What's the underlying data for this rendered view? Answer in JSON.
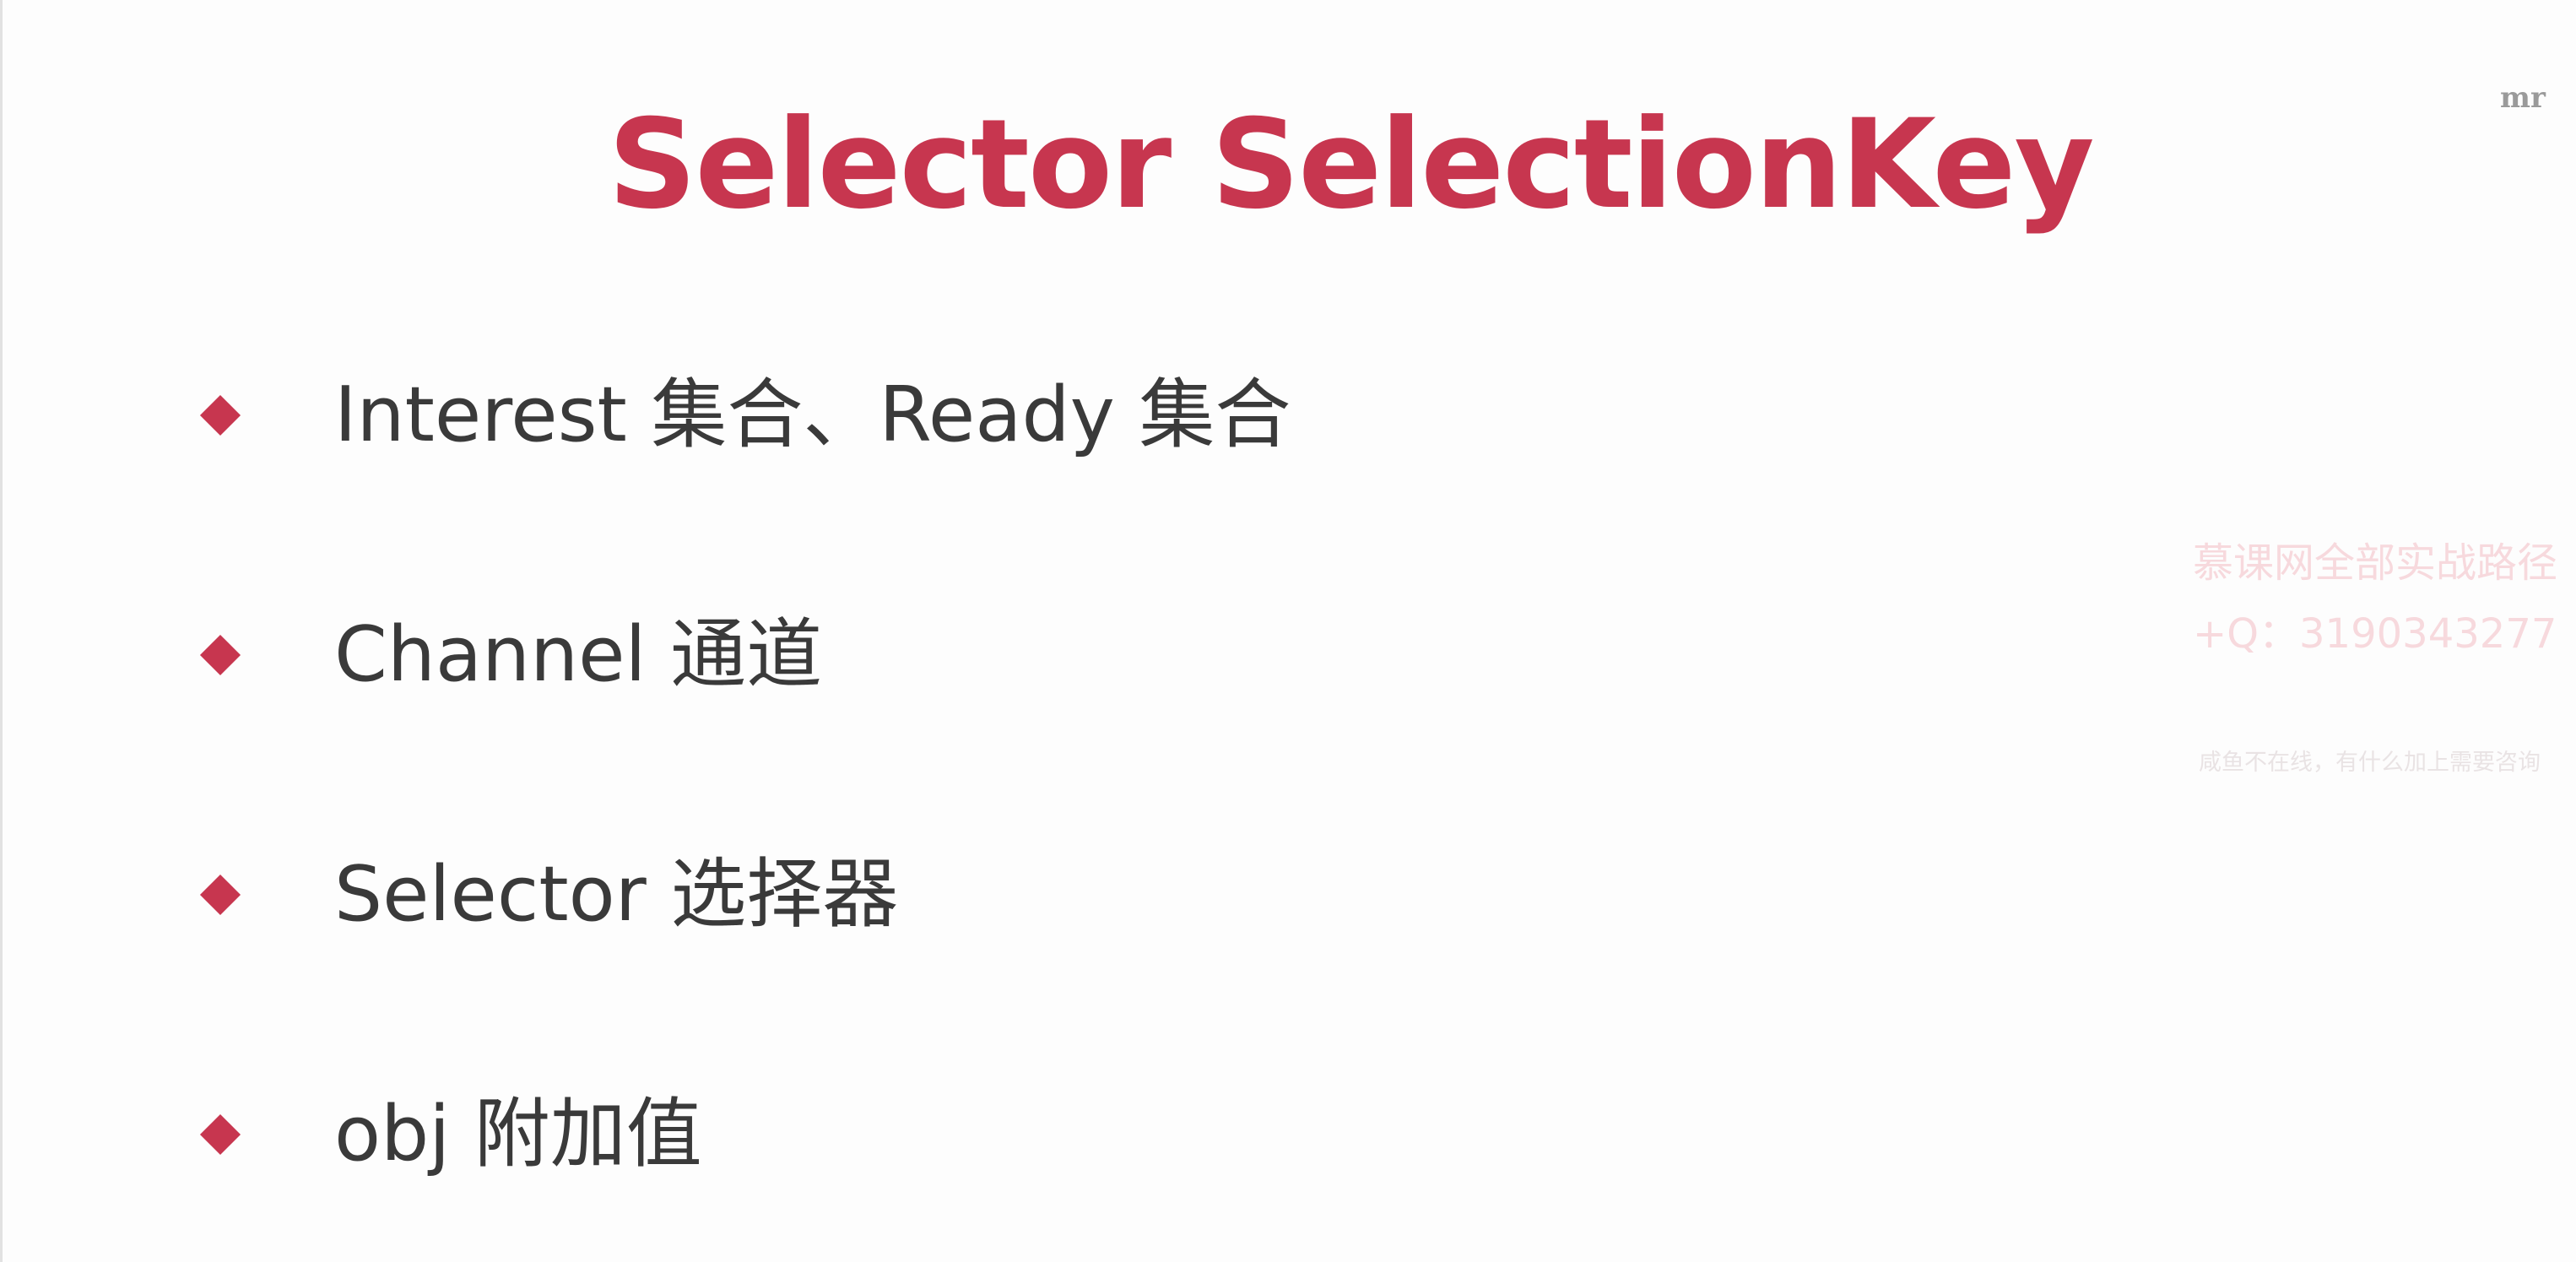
{
  "slide": {
    "title": "Selector SelectionKey",
    "corner_mark": "mr",
    "accent_color": "#c7364f",
    "text_color": "#3a3a3a",
    "bullets": [
      {
        "text": "Interest 集合、Ready 集合"
      },
      {
        "text": "Channel 通道"
      },
      {
        "text": "Selector 选择器"
      },
      {
        "text": "obj 附加值"
      }
    ],
    "watermark": {
      "line1": "慕课网全部实战路径",
      "line2": "+Q：3190343277",
      "line3": "咸鱼不在线，有什么加上需要咨询"
    }
  }
}
